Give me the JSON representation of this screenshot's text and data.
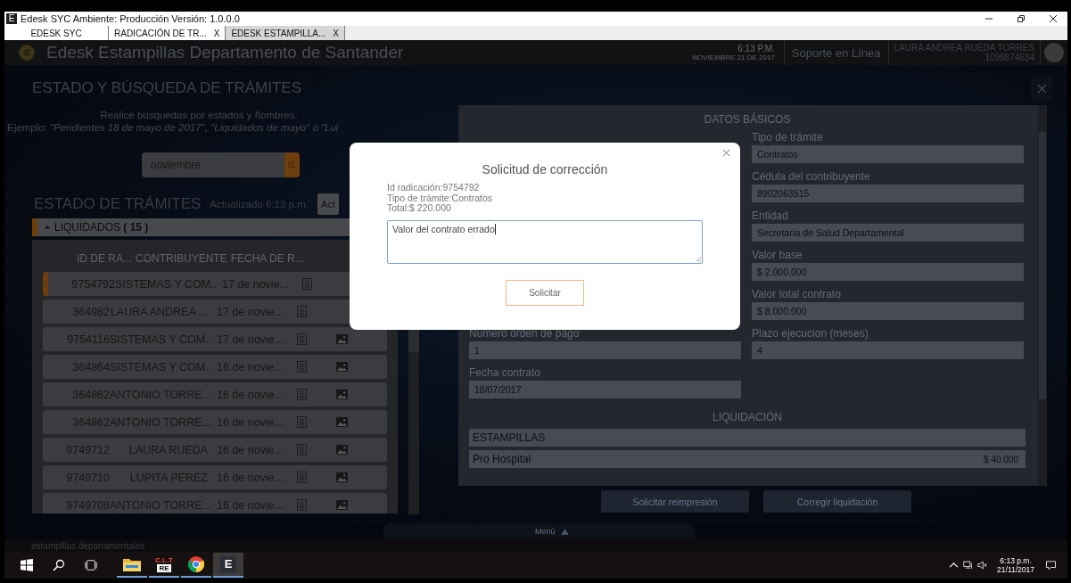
{
  "window": {
    "icon_letter": "E",
    "title": "Edesk SYC Ambiente: Producción  Versión: 1.0.0.0"
  },
  "tabs": [
    {
      "label": "EDESK SYC",
      "selected": false
    },
    {
      "label": "RADICACIÓN DE TR...",
      "close": "X",
      "selected": false
    },
    {
      "label": "EDESK ESTAMPILLA...",
      "close": "X",
      "selected": true
    }
  ],
  "header": {
    "title": "Edesk Estampillas Departamento de Santander",
    "time": "6:13 P.M.",
    "date": "NOVIEMBRE 21 DE 2017",
    "support": "Soporte en Línea",
    "user_name": "LAURA ANDREA RUEDA TORRES",
    "user_id": "1099874634"
  },
  "search_panel": {
    "title": "ESTADO Y BÚSQUEDA DE TRÁMITES",
    "hint": "Realice búsquedas por estados y ñombres.",
    "example_label": "Ejemplo:",
    "example": "\"Pendientes 18 de mayo de 2017\", \"Liquidados de mayo\" o \"Lui",
    "search_value": "noviembre"
  },
  "status": {
    "title": "ESTADO DE TRÁMITES",
    "updated": "Actualizado 6:13 p.m.",
    "button": "Act"
  },
  "group": {
    "label": "LIQUIDADOS",
    "count": "( 15 )",
    "expanded": true
  },
  "table": {
    "columns": [
      "ID DE RA...",
      "CONTRIBUYENTE",
      "FECHA DE R..."
    ],
    "rows": [
      {
        "id": "9754792",
        "contributor": "SISTEMAS Y COM..",
        "date": "17 de novie...",
        "selected": true,
        "image": false
      },
      {
        "id": "364982",
        "contributor": "LAURA ANDREA ...",
        "date": "17 de novie...",
        "selected": false,
        "image": false
      },
      {
        "id": "9754116",
        "contributor": "SISTEMAS Y COM..",
        "date": "17 de novie...",
        "selected": false,
        "image": true
      },
      {
        "id": "364864",
        "contributor": "SISTEMAS Y COM..",
        "date": "16 de novie...",
        "selected": false,
        "image": true
      },
      {
        "id": "364862",
        "contributor": "ANTONIO TORRE...",
        "date": "16 de novie...",
        "selected": false,
        "image": true
      },
      {
        "id": "364862",
        "contributor": "ANTONIO TORRE...",
        "date": "16 de novie...",
        "selected": false,
        "image": true
      },
      {
        "id": "9749712",
        "contributor": "LAURA RUEDA",
        "date": "16 de novie...",
        "selected": false,
        "image": true
      },
      {
        "id": "9749710",
        "contributor": "LUPITA PEREZ",
        "date": "16 de novie...",
        "selected": false,
        "image": true
      },
      {
        "id": "9749708",
        "contributor": "ANTONIO TORRE...",
        "date": "16 de novie...",
        "selected": false,
        "image": true
      }
    ]
  },
  "details": {
    "title": "DATOS BÁSICOS",
    "fields": [
      {
        "label": "Tipo de trámite",
        "value": "Contratos"
      },
      {
        "label": "Cédula del contribuyente",
        "value": "8902063515"
      },
      {
        "label": "Entidad",
        "value": "Secretaría de Salud Departamental"
      },
      {
        "label": "Valor base",
        "value": "$ 2.000.000"
      },
      {
        "label": "Valor total contrato",
        "value": "$ 8.000.000"
      }
    ],
    "lower_fields": [
      {
        "label": "Numero orden de pago",
        "value": "1"
      },
      {
        "label": "Plazo ejecucion (meses)",
        "value": "4"
      },
      {
        "label": "Fecha contrato",
        "value": "18/07/2017"
      }
    ],
    "liquidation_title": "LIQUIDACIÓN",
    "liquidation_rows": [
      {
        "kind": "header",
        "label": "ESTAMPILLAS"
      },
      {
        "kind": "item",
        "label": "Pro Hospital",
        "amount": "$ 40.000"
      }
    ]
  },
  "actions": [
    "Solicitar reimpresión",
    "Corregir liquidación"
  ],
  "menu_tab": "Menú",
  "footer": "estampillas departamentales",
  "modal": {
    "title": "Solicitud de corrección",
    "lines": [
      "Id radicación:9754792",
      "Tipo de trámite:Contratos",
      "Total:$ 220.000"
    ],
    "message": "Valor del contrato errado",
    "button": "Solicitar"
  },
  "taskbar": {
    "apps": [
      {
        "kind": "explorer",
        "selected": false
      },
      {
        "kind": "clt",
        "selected": false,
        "lines": [
          "C.L.T",
          "RE"
        ]
      },
      {
        "kind": "chrome",
        "selected": false
      },
      {
        "kind": "letter",
        "selected": true,
        "letter": "E"
      }
    ],
    "time": "6:13 p.m.",
    "date": "21/11/2017"
  }
}
